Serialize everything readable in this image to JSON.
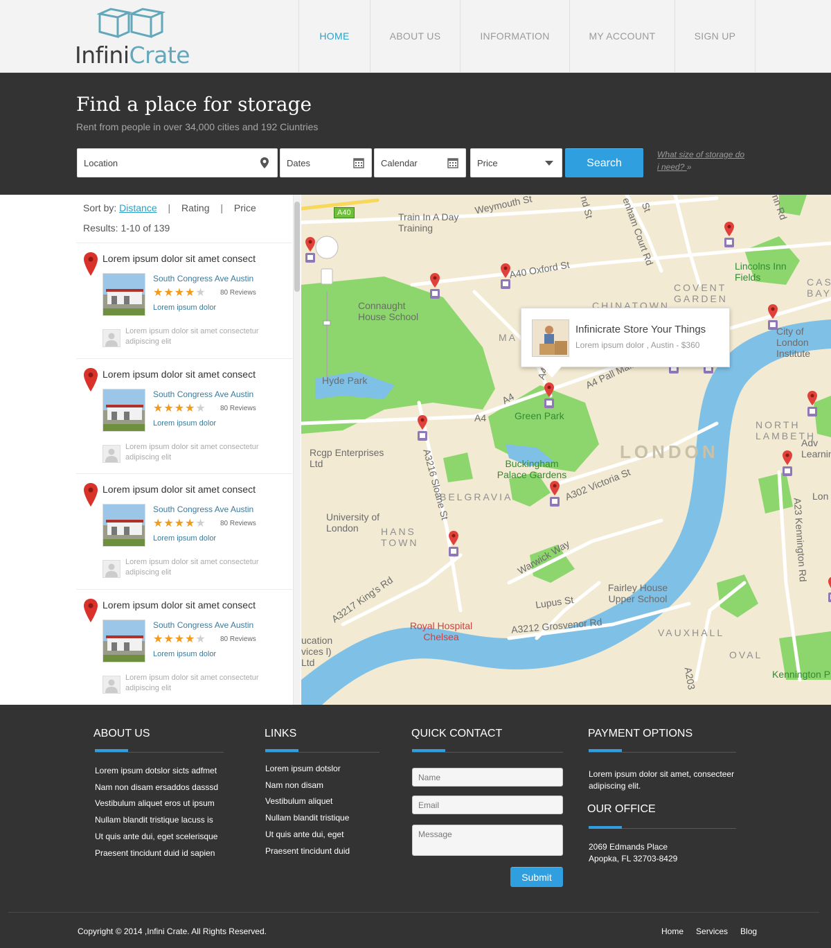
{
  "brand": {
    "name_part1": "Infini",
    "name_part2": "Crate"
  },
  "nav": [
    {
      "label": "HOME",
      "active": true
    },
    {
      "label": "ABOUT US"
    },
    {
      "label": "INFORMATION"
    },
    {
      "label": "MY ACCOUNT"
    },
    {
      "label": "SIGN UP"
    }
  ],
  "hero": {
    "title": "Find a place for storage",
    "subtitle": "Rent from people in over 34,000 cities and 192 Ciuntries",
    "location_placeholder": "Location",
    "dates_placeholder": "Dates",
    "calendar_placeholder": "Calendar",
    "price_label": "Price",
    "search_label": "Search",
    "size_link": "What size of storage do i need?"
  },
  "sort": {
    "label": "Sort by:",
    "options": [
      "Distance",
      "Rating",
      "Price"
    ],
    "active": "Distance",
    "results": "Results: 1-10 of 139"
  },
  "listings": [
    {
      "title": "Lorem ipsum dolor sit amet consect",
      "address": "South Congress Ave Austin",
      "rating": 4,
      "reviews": "80 Reviews",
      "subtitle": "Lorem ipsum dolor",
      "comment": "Lorem ipsum dolor sit amet consectetur adipiscing elit"
    },
    {
      "title": "Lorem ipsum dolor sit amet consect",
      "address": "South Congress Ave Austin",
      "rating": 4,
      "reviews": "80 Reviews",
      "subtitle": "Lorem ipsum dolor",
      "comment": "Lorem ipsum dolor sit amet consectetur adipiscing elit"
    },
    {
      "title": "Lorem ipsum dolor sit amet consect",
      "address": "South Congress Ave Austin",
      "rating": 4,
      "reviews": "80 Reviews",
      "subtitle": "Lorem ipsum dolor",
      "comment": "Lorem ipsum dolor sit amet consectetur adipiscing elit"
    },
    {
      "title": "Lorem ipsum dolor sit amet consect",
      "address": "South Congress Ave Austin",
      "rating": 4,
      "reviews": "80 Reviews",
      "subtitle": "Lorem ipsum dolor",
      "comment": "Lorem ipsum dolor sit amet consectetur adipiscing elit"
    }
  ],
  "map": {
    "popup_title": "Infinicrate Store Your Things",
    "popup_sub": "Lorem ipsum dolor , Austin - $360",
    "labels": {
      "a40_shield": "A40",
      "weymouth": "Weymouth St",
      "train": "Train In A Day Training",
      "oxford": "A40 Oxford St",
      "covent": "COVENT GARDEN",
      "lincolns": "Lincolns Inn Fields",
      "connaught": "Connaught House School",
      "chinatown": "CHINATOWN",
      "city": "City of London Institute",
      "hyde": "Hyde Park",
      "green": "Green Park",
      "a4": "A4",
      "a4b": "A4",
      "a4c": "A4",
      "pall": "A4 Pall Mall",
      "north_lambeth": "NORTH LAMBETH",
      "london": "LONDON",
      "rcgp": "Rcgp Enterprises Ltd",
      "buckingham": "Buckingham Palace Gardens",
      "belgravia": "BELGRAVIA",
      "a302": "A302 Victoria St",
      "a3216": "A3216 Sloane St",
      "university": "University of London",
      "hans": "HANS TOWN",
      "a23": "A23 Kennington Rd",
      "warwick": "Warwick Way",
      "fairley": "Fairley House Upper School",
      "lupus": "Lupus St",
      "kings": "A3217 King's Rd",
      "royal": "Royal Hospital Chelsea",
      "a3212": "A3212 Grosvenor Rd",
      "vauxhall": "VAUXHALL",
      "oval": "OVAL",
      "a203": "A203",
      "kennington": "Kennington P",
      "ucation": "ucation vices l) Ltd",
      "castle": "CAST BAYN",
      "adv": "Adv Learnin",
      "lon": "Lon",
      "ma": "MA",
      "nd_st": "nd St",
      "enham": "enham Court Rd",
      "nn": "nn Rd",
      "st": "St"
    }
  },
  "footer": {
    "about_title": "ABOUT US",
    "about_items": [
      "Lorem ipsum dotslor sicts adfmet",
      "Nam non disam ersaddos dasssd",
      "Vestibulum aliquet eros ut ipsum",
      "Nullam blandit tristique lacuss is",
      "Ut quis ante dui, eget scelerisque",
      "Praesent tincidunt duid id sapien"
    ],
    "links_title": "LINKS",
    "links_items": [
      "Lorem ipsum dotslor",
      "Nam non disam",
      "Vestibulum aliquet",
      "Nullam blandit tristique",
      "Ut quis ante dui, eget",
      "Praesent tincidunt duid"
    ],
    "contact_title": "QUICK CONTACT",
    "name_placeholder": "Name",
    "email_placeholder": "Email",
    "message_placeholder": "Message",
    "submit_label": "Submit",
    "payment_title": "PAYMENT OPTIONS",
    "payment_text": "Lorem ipsum dolor sit amet, consecteer adipiscing elit.",
    "office_title": "OUR OFFICE",
    "office_line1": "2069 Edmands Place",
    "office_line2": "Apopka, FL  32703-8429",
    "copyright": "Copyright © 2014  ,Infini Crate. All Rights Reserved.",
    "bottom_links": [
      "Home",
      "Services",
      "Blog"
    ]
  },
  "colors": {
    "accent": "#2f9fe0",
    "nav_active": "#2aa0c6",
    "dark_bg": "#333333",
    "star": "#f29a1a",
    "pin": "#d9322b",
    "park": "#8cd66d",
    "river": "#7ec0e6"
  }
}
